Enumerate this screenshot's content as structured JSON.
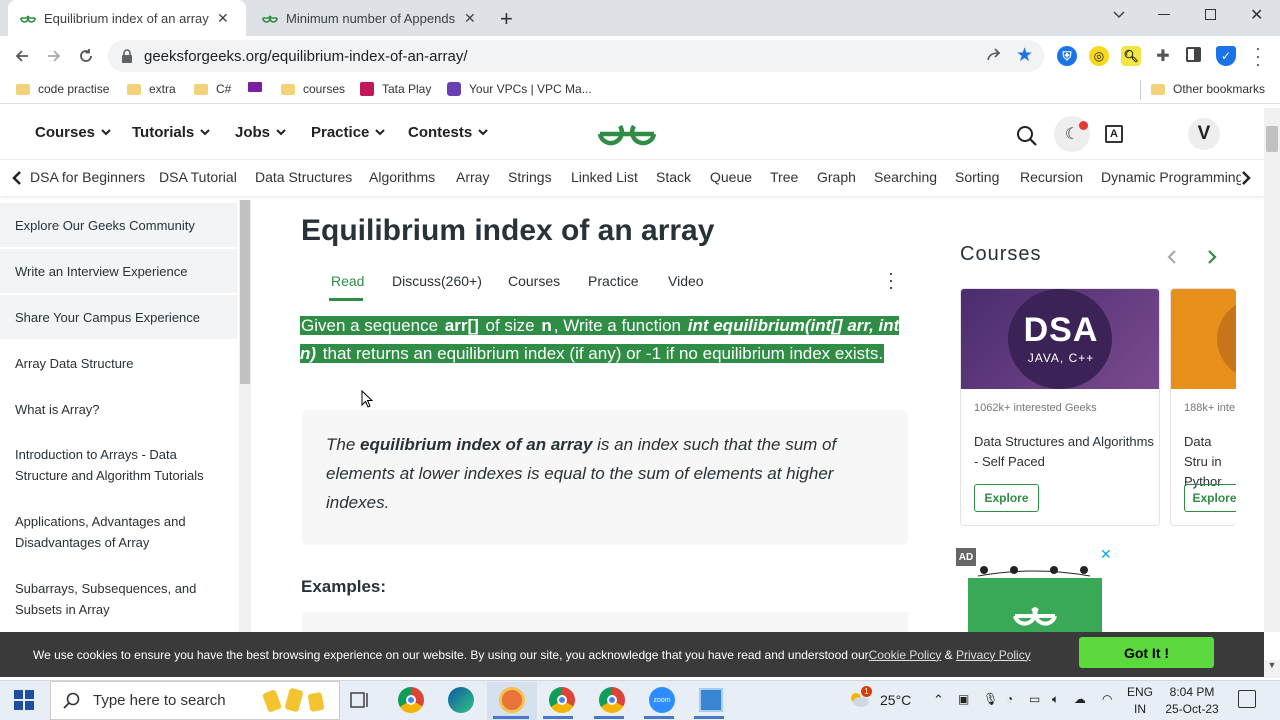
{
  "browser": {
    "tabs": [
      {
        "title": "Equilibrium index of an array - G",
        "active": true
      },
      {
        "title": "Minimum number of Appends n",
        "active": false
      }
    ],
    "new_tab": "+",
    "url": "geeksforgeeks.org/equilibrium-index-of-an-array/",
    "bookmarks": [
      "code practise",
      "extra",
      "C#",
      "courses",
      "Tata Play",
      "Your VPCs | VPC Ma..."
    ],
    "other_bookmarks": "Other bookmarks",
    "window_controls": [
      "minimize",
      "restore",
      "close"
    ]
  },
  "site": {
    "menus": [
      "Courses",
      "Tutorials",
      "Jobs",
      "Practice",
      "Contests"
    ],
    "avatar_letter": "V",
    "logo_text": "ƏG",
    "subnav": [
      "DSA for Beginners",
      "DSA Tutorial",
      "Data Structures",
      "Algorithms",
      "Array",
      "Strings",
      "Linked List",
      "Stack",
      "Queue",
      "Tree",
      "Graph",
      "Searching",
      "Sorting",
      "Recursion",
      "Dynamic Programming"
    ]
  },
  "sidebar": {
    "items": [
      "Explore Our Geeks Community",
      "Write an Interview Experience",
      "Share Your Campus Experience",
      "Array Data Structure",
      "What is Array?",
      "Introduction to Arrays - Data Structure and Algorithm Tutorials",
      "Applications, Advantages and Disadvantages of Array",
      "Subarrays, Subsequences, and Subsets in Array"
    ]
  },
  "article": {
    "title": "Equilibrium index of an array",
    "tabs": [
      "Read",
      "Discuss(260+)",
      "Courses",
      "Practice",
      "Video"
    ],
    "intro": {
      "p1": "Given a sequence ",
      "b1": "arr[]",
      "p2": " of size ",
      "b2": "n",
      "p3": ", Write a function ",
      "bi1": "int equilibrium(int[] arr, int n)",
      "p4": " that returns an equilibrium index (if any) or -1 if no equilibrium index exists."
    },
    "quote": {
      "q1": "The ",
      "qb": "equilibrium index of an array",
      "q2": " is an index such that the sum of elements at lower indexes is equal to the sum of elements at higher indexes."
    },
    "examples_heading": "Examples:"
  },
  "courses": {
    "heading": "Courses",
    "cards": [
      {
        "image_title": "DSA",
        "image_sub": "JAVA, C++",
        "interest": "1062k+ interested Geeks",
        "name": "Data Structures and Algorithms - Self Paced",
        "button": "Explore"
      },
      {
        "interest": "188k+ inte",
        "name": "Data Stru in Pythor",
        "button": "Explore"
      }
    ],
    "ad_label": "AD",
    "ad_close": "✕"
  },
  "cookie": {
    "text": "We use cookies to ensure you have the best browsing experience on our website. By using our site, you acknowledge that you have read and understood our ",
    "cookie_link": "Cookie Policy",
    "amp": " & ",
    "privacy_link": "Privacy Policy",
    "button": "Got It !"
  },
  "taskbar": {
    "search_placeholder": "Type here to search",
    "weather": "25°C",
    "lang": "ENG",
    "region": "IN",
    "time": "8:04 PM",
    "date": "25-Oct-23",
    "weather_badge": "1"
  },
  "colors": {
    "gfg_green": "#2f8d46",
    "got_it": "#5cda3d",
    "cookie_bg": "#3a3a3a"
  }
}
